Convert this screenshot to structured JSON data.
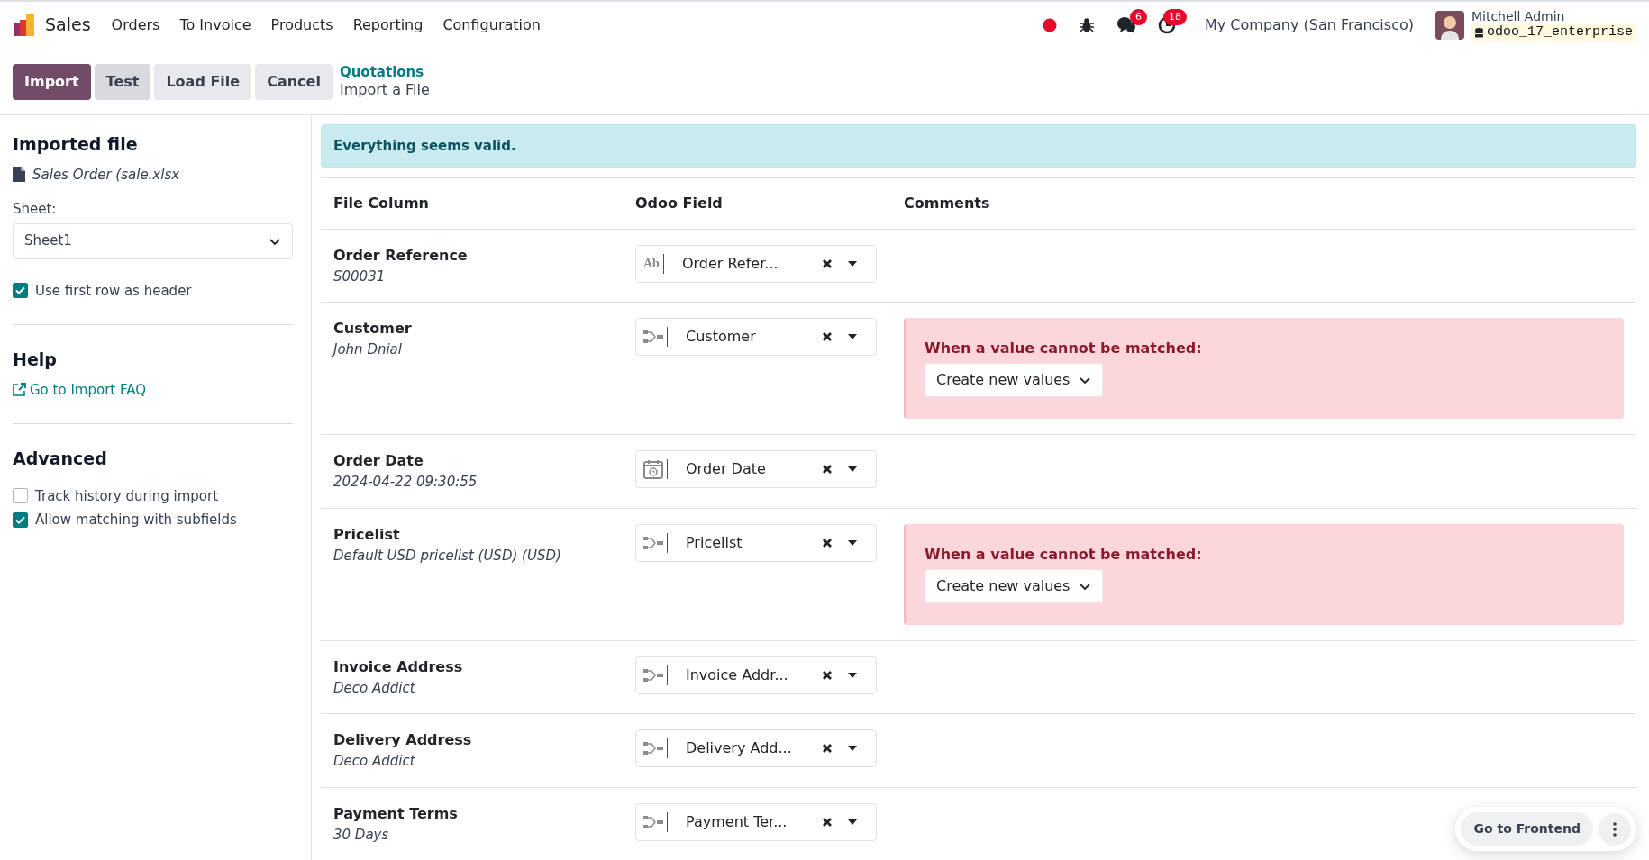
{
  "navbar": {
    "app": "Sales",
    "menu": [
      "Orders",
      "To Invoice",
      "Products",
      "Reporting",
      "Configuration"
    ],
    "messages_badge": "6",
    "activities_badge": "18",
    "company": "My Company (San Francisco)",
    "user": "Mitchell Admin",
    "database": "odoo_17_enterprise"
  },
  "control_panel": {
    "buttons": [
      {
        "label": "Import",
        "kind": "primary"
      },
      {
        "label": "Test",
        "kind": "active"
      },
      {
        "label": "Load File",
        "kind": "secondary"
      },
      {
        "label": "Cancel",
        "kind": "secondary"
      }
    ],
    "breadcrumb": "Quotations",
    "title": "Import a File"
  },
  "sidebar": {
    "imported_file_title": "Imported file",
    "file_name": "Sales Order (sale.xlsx",
    "sheet_label": "Sheet:",
    "sheet_value": "Sheet1",
    "header_option": {
      "label": "Use first row as header",
      "checked": true
    },
    "help_title": "Help",
    "help_link": "Go to Import FAQ",
    "advanced_title": "Advanced",
    "options": [
      {
        "label": "Track history during import",
        "checked": false
      },
      {
        "label": "Allow matching with subfields",
        "checked": true
      }
    ]
  },
  "alert": "Everything seems valid.",
  "table": {
    "columns": [
      "File Column",
      "Odoo Field",
      "Comments"
    ],
    "rows": [
      {
        "file_column": "Order Reference",
        "sample": "S00031",
        "kind": "text",
        "type_icon": "Ab",
        "field": "Order Refer..."
      },
      {
        "file_column": "Customer",
        "sample": "John Dnial",
        "kind": "relation",
        "field": "Customer",
        "comment": {
          "label": "When a value cannot be matched:",
          "option": "Create new values"
        }
      },
      {
        "file_column": "Order Date",
        "sample": "2024-04-22 09:30:55",
        "kind": "date",
        "field": "Order Date"
      },
      {
        "file_column": "Pricelist",
        "sample": "Default USD pricelist (USD) (USD)",
        "kind": "relation",
        "field": "Pricelist",
        "comment": {
          "label": "When a value cannot be matched:",
          "option": "Create new values"
        }
      },
      {
        "file_column": "Invoice Address",
        "sample": "Deco Addict",
        "kind": "relation",
        "field": "Invoice Addr..."
      },
      {
        "file_column": "Delivery Address",
        "sample": "Deco Addict",
        "kind": "relation",
        "field": "Delivery Add..."
      },
      {
        "file_column": "Payment Terms",
        "sample": "30 Days",
        "kind": "relation",
        "field": "Payment Ter..."
      }
    ]
  },
  "floating": {
    "button": "Go to Frontend"
  }
}
